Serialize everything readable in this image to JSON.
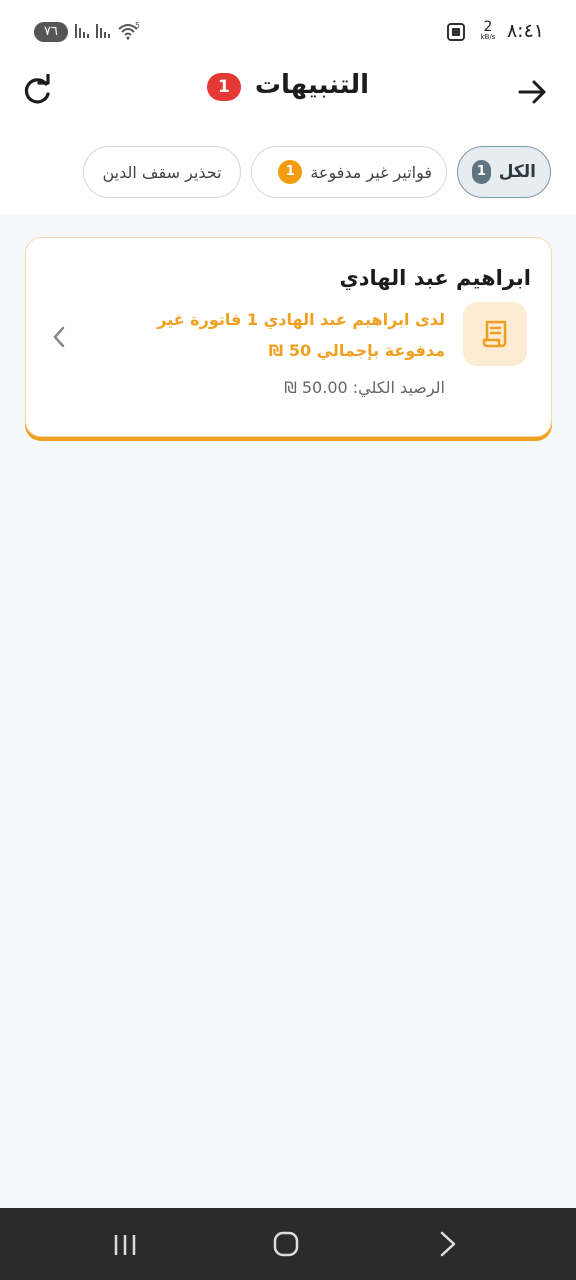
{
  "status_bar": {
    "time": "٨:٤١",
    "speed_value": "2",
    "speed_unit": "kB/s",
    "battery": "٧٦",
    "wifi_label": "5"
  },
  "header": {
    "title": "التنبيهات",
    "badge": "1"
  },
  "tabs": [
    {
      "label": "الكل",
      "count": "1",
      "selected": true
    },
    {
      "label": "فواتير غير مدفوعة",
      "count": "1",
      "selected": false
    },
    {
      "label": "تحذير سقف الدين",
      "selected": false
    }
  ],
  "notification": {
    "name": "ابراهيم عبد الهادي",
    "message": "لدى ابراهيم عبد الهادي 1 فاتورة غير مدفوعة بإجمالي 50 ₪",
    "balance": "الرصيد الكلي: 50.00 ₪"
  },
  "colors": {
    "accent": "#f0a020",
    "badge_red": "#e53935",
    "chip_selected": "#e6ecf0"
  },
  "icons": [
    "arrow-right-icon",
    "refresh-icon",
    "receipt-icon",
    "chevron-left-icon"
  ]
}
